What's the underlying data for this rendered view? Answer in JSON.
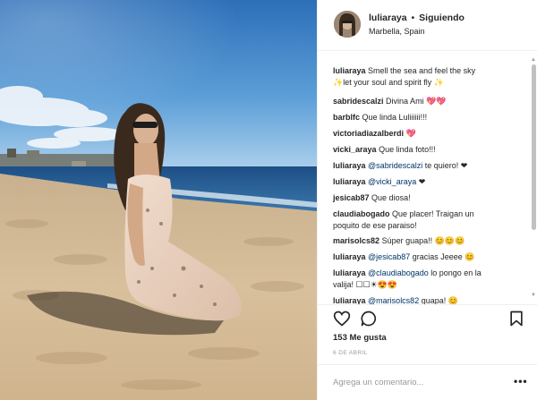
{
  "header": {
    "username": "luliaraya",
    "separator": "•",
    "follow_status": "Siguiendo",
    "location": "Marbella, Spain"
  },
  "comments": [
    {
      "user": "luliaraya",
      "text": "Smell the sea and feel the sky",
      "text2": "✨let your soul and spirit fly ✨"
    },
    {
      "user": "sabridescalzi",
      "text": "Divina Ami 💖💖"
    },
    {
      "user": "barblfc",
      "text": "Que linda Luliiiiii!!!"
    },
    {
      "user": "victoriadiazalberdi",
      "text": "💖"
    },
    {
      "user": "vicki_araya",
      "text": "Que linda foto!!!"
    },
    {
      "user": "luliaraya",
      "mention": "@sabridescalzi",
      "text": "te quiero! ❤"
    },
    {
      "user": "luliaraya",
      "mention": "@vicki_araya",
      "text": "❤"
    },
    {
      "user": "jesicab87",
      "text": "Que diosa!"
    },
    {
      "user": "claudiabogado",
      "text": "Que placer! Traigan un",
      "text2": "poquito de ese paraiso!"
    },
    {
      "user": "marisolcs82",
      "text": "Súper guapa!! 😊😊😊"
    },
    {
      "user": "luliaraya",
      "mention": "@jesicab87",
      "text": "gracias Jeeee 😊"
    },
    {
      "user": "luliaraya",
      "mention": "@claudiabogado",
      "text": "lo pongo en la",
      "text2": "valija! ☐☐☀😍😍"
    },
    {
      "user": "luliaraya",
      "mention": "@marisolcs82",
      "text": "guapa! 😊"
    }
  ],
  "actions": {
    "like_icon": "heart-icon",
    "comment_icon": "comment-icon",
    "save_icon": "bookmark-icon"
  },
  "likes": "153 Me gusta",
  "date": "6 DE ABRIL",
  "add_comment": {
    "placeholder": "Agrega un comentario...",
    "more_label": "•••"
  },
  "colors": {
    "mention": "#003569",
    "border": "#efefef",
    "text": "#262626",
    "muted": "#999999"
  }
}
